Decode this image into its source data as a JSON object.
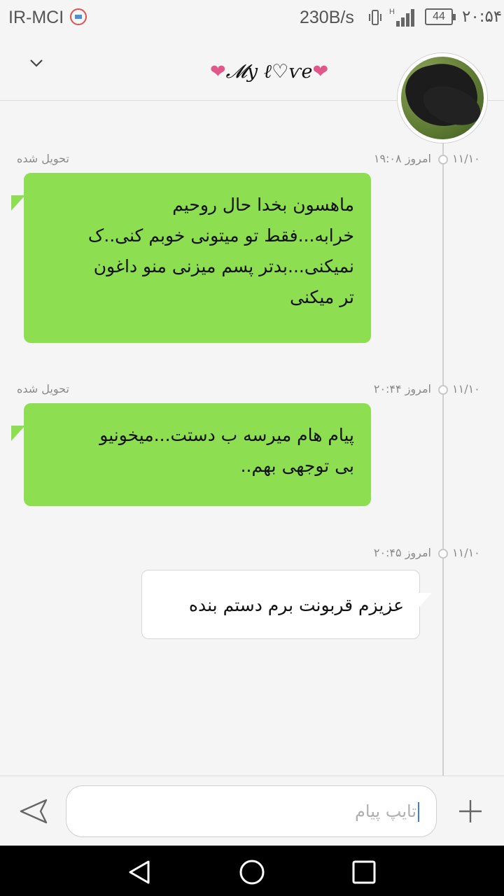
{
  "status_bar": {
    "carrier": "IR-MCI",
    "speed": "230B/s",
    "battery": "44",
    "time": "۲۰:۵۴",
    "icons": [
      "app-notification-icon",
      "vibrate-icon",
      "signal-icon",
      "battery-icon"
    ]
  },
  "header": {
    "title_prefix_heart": "❤",
    "title_text": "𝓜y ℓ♡ѵe",
    "title_suffix_heart": "❤",
    "collapse_icon": "chevron-down-icon"
  },
  "messages": [
    {
      "date": "۱۱/۱۰",
      "time": "امروز ۱۹:۰۸",
      "status": "تحویل شده",
      "direction": "sent",
      "text": "ماهسون بخدا حال روحیم\nخرابه...فقط تو میتونی خوبم کنی..ک\nنمیکنی...بدتر پسم میزنی منو داغون\nتر میکنی"
    },
    {
      "date": "۱۱/۱۰",
      "time": "امروز ۲۰:۴۴",
      "status": "تحویل شده",
      "direction": "sent",
      "text": "پیام هام میرسه ب دستت...میخونیو\nبی توجهی بهم.."
    },
    {
      "date": "۱۱/۱۰",
      "time": "امروز ۲۰:۴۵",
      "status": "",
      "direction": "received",
      "text": "عزیزم قربونت برم دستم بنده"
    }
  ],
  "input": {
    "placeholder": "تایپ پیام",
    "send_icon": "send-icon",
    "attach_icon": "plus-icon"
  },
  "navbar": {
    "icons": [
      "back-icon",
      "home-icon",
      "recents-icon"
    ]
  },
  "colors": {
    "sent_bubble": "#8ddf51",
    "received_bubble": "#ffffff",
    "heart": "#e0588a",
    "background": "#f5f5f5"
  }
}
